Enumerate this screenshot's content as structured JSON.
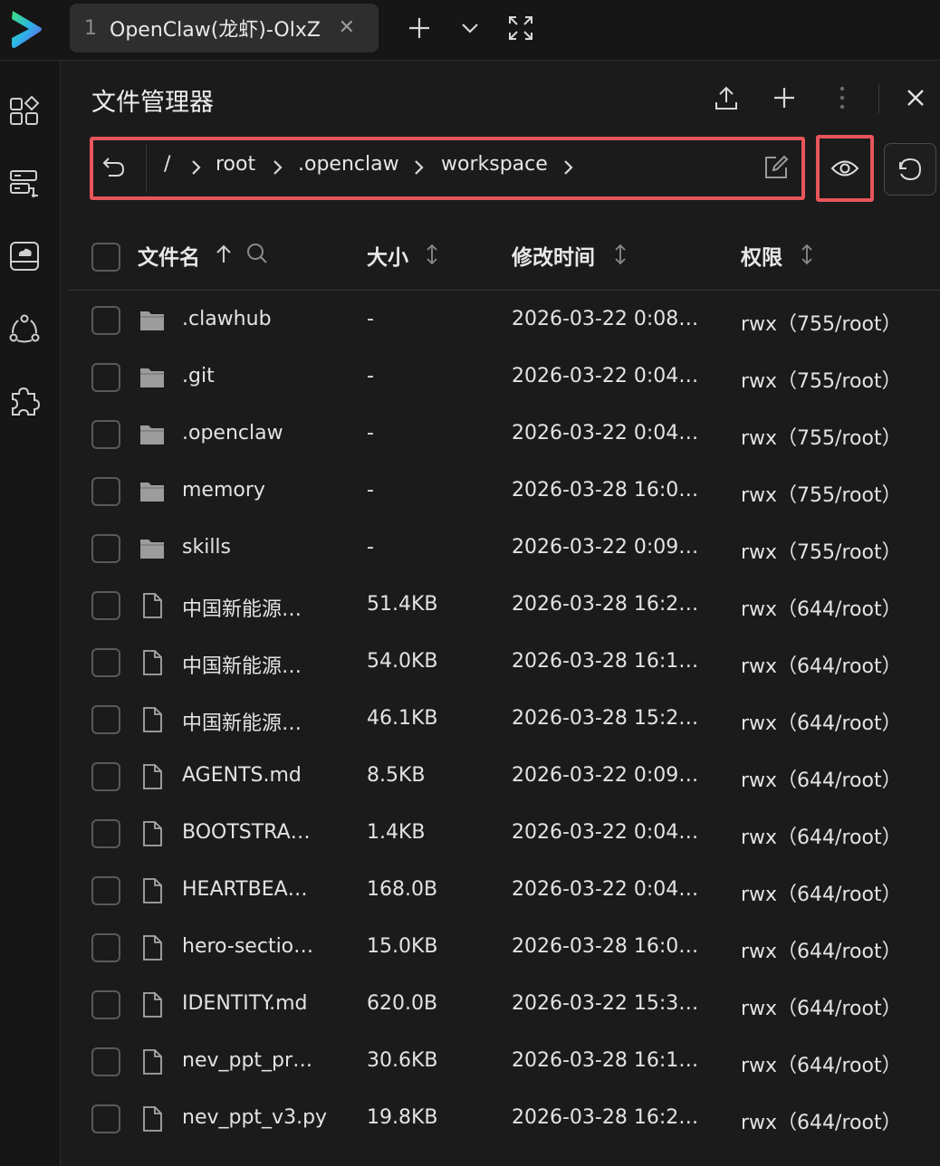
{
  "topbar": {
    "tab_number": "1",
    "tab_title": "OpenClaw(龙虾)-OlxZ",
    "tab_close": "✕"
  },
  "panel": {
    "title": "文件管理器"
  },
  "path": {
    "root": "/",
    "segments": [
      "root",
      ".openclaw",
      "workspace"
    ]
  },
  "table": {
    "headers": {
      "name": "文件名",
      "size": "大小",
      "modified": "修改时间",
      "permissions": "权限"
    },
    "rows": [
      {
        "type": "folder",
        "name": ".clawhub",
        "size": "-",
        "modified": "2026-03-22 0:08…",
        "perm": "rwx（755/root）"
      },
      {
        "type": "folder",
        "name": ".git",
        "size": "-",
        "modified": "2026-03-22 0:04…",
        "perm": "rwx（755/root）"
      },
      {
        "type": "folder",
        "name": ".openclaw",
        "size": "-",
        "modified": "2026-03-22 0:04…",
        "perm": "rwx（755/root）"
      },
      {
        "type": "folder",
        "name": "memory",
        "size": "-",
        "modified": "2026-03-28 16:0…",
        "perm": "rwx（755/root）"
      },
      {
        "type": "folder",
        "name": "skills",
        "size": "-",
        "modified": "2026-03-22 0:09…",
        "perm": "rwx（755/root）"
      },
      {
        "type": "file",
        "name": "中国新能源…",
        "size": "51.4KB",
        "modified": "2026-03-28 16:2…",
        "perm": "rwx（644/root）"
      },
      {
        "type": "file",
        "name": "中国新能源…",
        "size": "54.0KB",
        "modified": "2026-03-28 16:1…",
        "perm": "rwx（644/root）"
      },
      {
        "type": "file",
        "name": "中国新能源…",
        "size": "46.1KB",
        "modified": "2026-03-28 15:2…",
        "perm": "rwx（644/root）"
      },
      {
        "type": "file",
        "name": "AGENTS.md",
        "size": "8.5KB",
        "modified": "2026-03-22 0:09…",
        "perm": "rwx（644/root）"
      },
      {
        "type": "file",
        "name": "BOOTSTRA…",
        "size": "1.4KB",
        "modified": "2026-03-22 0:04…",
        "perm": "rwx（644/root）"
      },
      {
        "type": "file",
        "name": "HEARTBEA…",
        "size": "168.0B",
        "modified": "2026-03-22 0:04…",
        "perm": "rwx（644/root）"
      },
      {
        "type": "file",
        "name": "hero-sectio…",
        "size": "15.0KB",
        "modified": "2026-03-28 16:0…",
        "perm": "rwx（644/root）"
      },
      {
        "type": "file",
        "name": "IDENTITY.md",
        "size": "620.0B",
        "modified": "2026-03-22 15:3…",
        "perm": "rwx（644/root）"
      },
      {
        "type": "file",
        "name": "nev_ppt_pr…",
        "size": "30.6KB",
        "modified": "2026-03-28 16:1…",
        "perm": "rwx（644/root）"
      },
      {
        "type": "file",
        "name": "nev_ppt_v3.py",
        "size": "19.8KB",
        "modified": "2026-03-28 16:2…",
        "perm": "rwx（644/root）"
      }
    ]
  },
  "colors": {
    "highlight": "#e8555a",
    "background": "#1b1b1b",
    "text": "#e6e6e6"
  }
}
